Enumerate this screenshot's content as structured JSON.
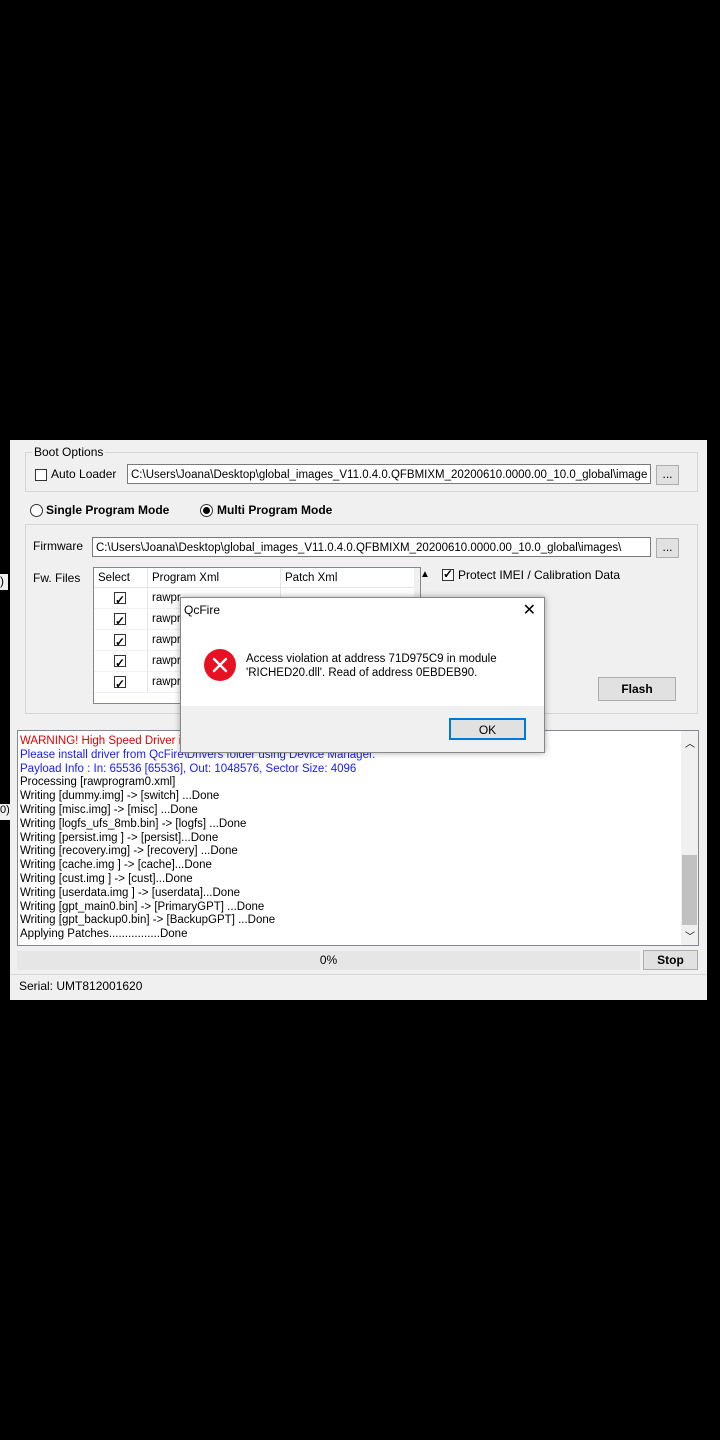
{
  "boot_options": {
    "legend": "Boot Options",
    "auto_loader_label": "Auto Loader",
    "auto_loader_checked": false,
    "auto_loader_path": "C:\\Users\\Joana\\Desktop\\global_images_V11.0.4.0.QFBMIXM_20200610.0000.00_10.0_global\\image",
    "browse_label": "..."
  },
  "modes": {
    "single_label": "Single Program Mode",
    "multi_label": "Multi Program Mode",
    "selected": "multi"
  },
  "firmware": {
    "label": "Firmware",
    "path": "C:\\Users\\Joana\\Desktop\\global_images_V11.0.4.0.QFBMIXM_20200610.0000.00_10.0_global\\images\\",
    "browse_label": "..."
  },
  "fw_files": {
    "label": "Fw. Files",
    "columns": [
      "Select",
      "Program Xml",
      "Patch Xml"
    ],
    "rows": [
      {
        "checked": true,
        "program": "rawpr"
      },
      {
        "checked": true,
        "program": "rawpr"
      },
      {
        "checked": true,
        "program": "rawpr"
      },
      {
        "checked": true,
        "program": "rawpr"
      },
      {
        "checked": true,
        "program": "rawpr"
      }
    ]
  },
  "options": {
    "protect_imei_label": "Protect IMEI / Calibration Data",
    "protect_imei_checked": true
  },
  "flash_button": "Flash",
  "log": {
    "lines": [
      {
        "text": "WARNING! High Speed Driver is",
        "color": "#e00000"
      },
      {
        "text": "Please install driver from QcFire\\Drivers folder using Device Manager.",
        "color": "#1a1aff"
      },
      {
        "text": "Payload Info  : In: 65536 [65536], Out: 1048576, Sector Size: 4096",
        "color": "#1a1aff"
      },
      {
        "text": "Processing [rawprogram0.xml]",
        "color": "#000000"
      },
      {
        "text": "Writing [dummy.img] -> [switch] ...Done",
        "color": "#000000"
      },
      {
        "text": "Writing [misc.img] -> [misc] ...Done",
        "color": "#000000"
      },
      {
        "text": "Writing [logfs_ufs_8mb.bin] -> [logfs] ...Done",
        "color": "#000000"
      },
      {
        "text": "Writing [persist.img ] -> [persist]...Done",
        "color": "#000000"
      },
      {
        "text": "Writing [recovery.img] -> [recovery] ...Done",
        "color": "#000000"
      },
      {
        "text": "Writing [cache.img ] -> [cache]...Done",
        "color": "#000000"
      },
      {
        "text": "Writing [cust.img ] -> [cust]...Done",
        "color": "#000000"
      },
      {
        "text": "Writing [userdata.img ] -> [userdata]...Done",
        "color": "#000000"
      },
      {
        "text": "Writing [gpt_main0.bin] -> [PrimaryGPT] ...Done",
        "color": "#000000"
      },
      {
        "text": "Writing [gpt_backup0.bin] -> [BackupGPT] ...Done",
        "color": "#000000"
      },
      {
        "text": "Applying Patches................Done",
        "color": "#000000"
      }
    ]
  },
  "progress": {
    "value": 0,
    "label": "0%"
  },
  "stop_button": "Stop",
  "status": {
    "serial": "Serial: UMT812001620"
  },
  "left_edge_fragments": [
    ")",
    "0)"
  ],
  "dialog": {
    "title": "QcFire",
    "message_line1": "Access violation at address 71D975C9 in module",
    "message_line2": "'RICHED20.dll'. Read of address 0EBDEB90.",
    "ok_label": "OK",
    "close_glyph": "✕",
    "icon": "error-icon"
  }
}
